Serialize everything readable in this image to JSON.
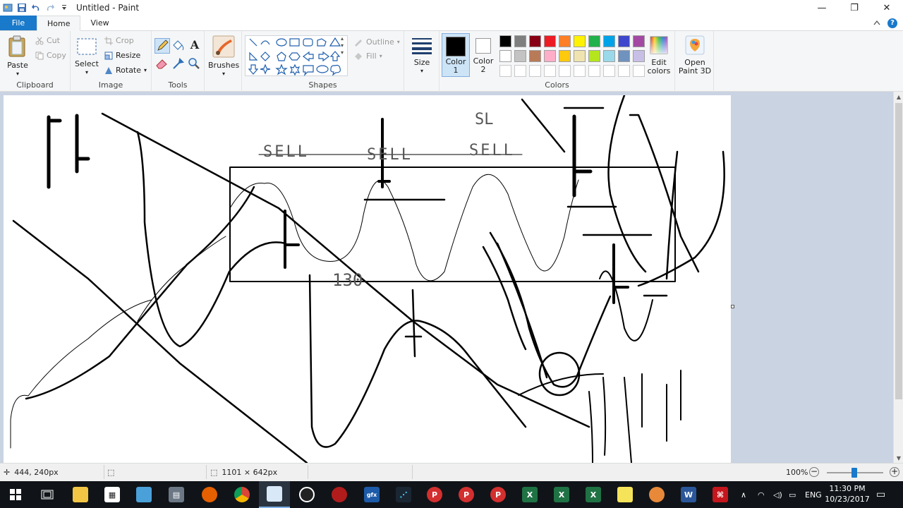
{
  "window": {
    "title": "Untitled - Paint",
    "controls": {
      "minimize": "—",
      "maximize": "❐",
      "close": "✕"
    }
  },
  "tabs": [
    {
      "label": "File"
    },
    {
      "label": "Home"
    },
    {
      "label": "View"
    }
  ],
  "ribbon": {
    "clipboard": {
      "label": "Clipboard",
      "paste": "Paste",
      "cut": "Cut",
      "copy": "Copy"
    },
    "image": {
      "label": "Image",
      "select": "Select",
      "crop": "Crop",
      "resize": "Resize",
      "rotate": "Rotate"
    },
    "tools": {
      "label": "Tools"
    },
    "brushes": {
      "label": "Brushes"
    },
    "shapes": {
      "label": "Shapes",
      "outline": "Outline",
      "fill": "Fill"
    },
    "size": {
      "label": "Size"
    },
    "colors": {
      "label": "Colors",
      "color1": "Color",
      "color1_num": "1",
      "color2": "Color",
      "color2_num": "2",
      "color1_value": "#000000",
      "color2_value": "#ffffff",
      "edit_colors": "Edit",
      "edit_colors2": "colors",
      "palette_row1": [
        "#000000",
        "#7f7f7f",
        "#880015",
        "#ed1c24",
        "#ff7f27",
        "#fff200",
        "#22b14c",
        "#00a2e8",
        "#3f48cc",
        "#a349a4"
      ],
      "palette_row2": [
        "#ffffff",
        "#c3c3c3",
        "#b97a57",
        "#ffaec9",
        "#ffc90e",
        "#efe4b0",
        "#b5e61d",
        "#99d9ea",
        "#7092be",
        "#c8bfe7"
      ]
    },
    "paint3d": {
      "label1": "Open",
      "label2": "Paint 3D"
    }
  },
  "canvas_text": {
    "sell1": "SELL",
    "sell2": "SELL",
    "sell3": "SELL",
    "sl": "SL",
    "num": "130"
  },
  "statusbar": {
    "cursor_pos": "444, 240px",
    "selection_size": "",
    "image_size": "1101 × 642px",
    "zoom": "100%"
  },
  "taskbar": {
    "time": "11:30 PM",
    "date": "10/23/2017",
    "language": "ENG"
  }
}
